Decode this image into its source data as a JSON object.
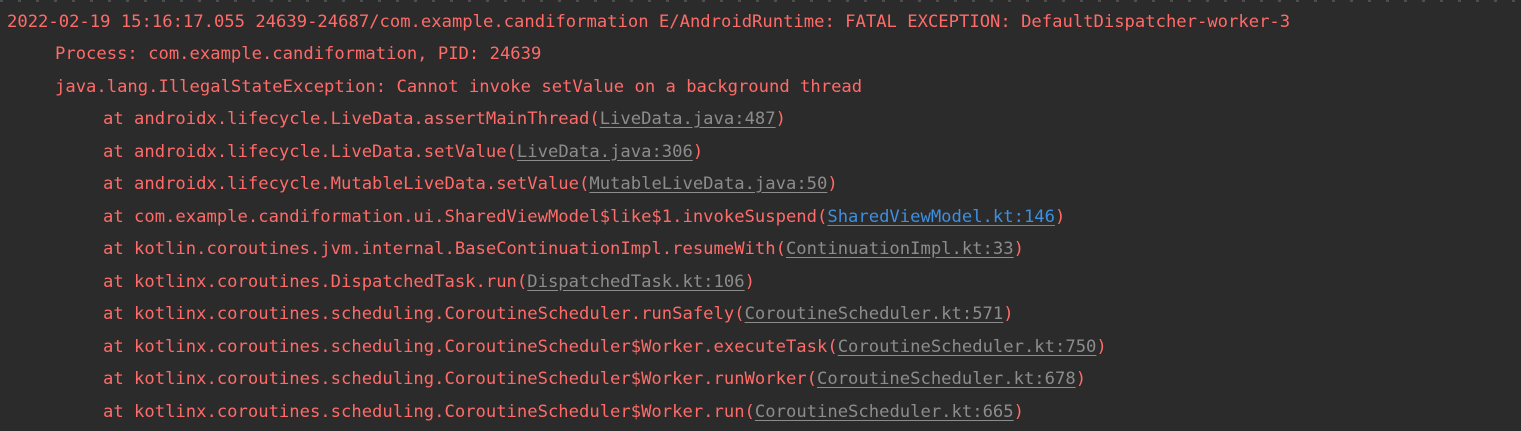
{
  "colors": {
    "background": "#2b2b2b",
    "error_text": "#ff6b68",
    "library_link": "#8c8c8c",
    "project_link": "#3d8fe0"
  },
  "log": {
    "header": "2022-02-19 15:16:17.055 24639-24687/com.example.candiformation E/AndroidRuntime: FATAL EXCEPTION: DefaultDispatcher-worker-3",
    "process": "Process: com.example.candiformation, PID: 24639",
    "exception": "java.lang.IllegalStateException: Cannot invoke setValue on a background thread",
    "frames": [
      {
        "method": "at androidx.lifecycle.LiveData.assertMainThread(",
        "link": "LiveData.java:487",
        "close": ")",
        "link_type": "library"
      },
      {
        "method": "at androidx.lifecycle.LiveData.setValue(",
        "link": "LiveData.java:306",
        "close": ")",
        "link_type": "library"
      },
      {
        "method": "at androidx.lifecycle.MutableLiveData.setValue(",
        "link": "MutableLiveData.java:50",
        "close": ")",
        "link_type": "library"
      },
      {
        "method": "at com.example.candiformation.ui.SharedViewModel$like$1.invokeSuspend(",
        "link": "SharedViewModel.kt:146",
        "close": ")",
        "link_type": "project"
      },
      {
        "method": "at kotlin.coroutines.jvm.internal.BaseContinuationImpl.resumeWith(",
        "link": "ContinuationImpl.kt:33",
        "close": ")",
        "link_type": "library"
      },
      {
        "method": "at kotlinx.coroutines.DispatchedTask.run(",
        "link": "DispatchedTask.kt:106",
        "close": ")",
        "link_type": "library"
      },
      {
        "method": "at kotlinx.coroutines.scheduling.CoroutineScheduler.runSafely(",
        "link": "CoroutineScheduler.kt:571",
        "close": ")",
        "link_type": "library"
      },
      {
        "method": "at kotlinx.coroutines.scheduling.CoroutineScheduler$Worker.executeTask(",
        "link": "CoroutineScheduler.kt:750",
        "close": ")",
        "link_type": "library"
      },
      {
        "method": "at kotlinx.coroutines.scheduling.CoroutineScheduler$Worker.runWorker(",
        "link": "CoroutineScheduler.kt:678",
        "close": ")",
        "link_type": "library"
      },
      {
        "method": "at kotlinx.coroutines.scheduling.CoroutineScheduler$Worker.run(",
        "link": "CoroutineScheduler.kt:665",
        "close": ")",
        "link_type": "library"
      }
    ]
  }
}
